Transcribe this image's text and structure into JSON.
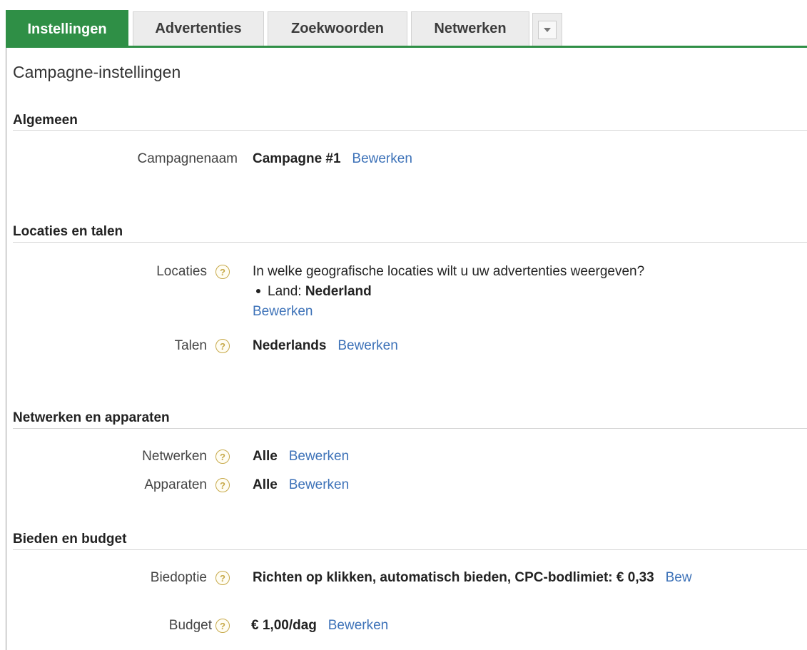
{
  "tabs": [
    {
      "label": "Instellingen",
      "active": true
    },
    {
      "label": "Advertenties",
      "active": false
    },
    {
      "label": "Zoekwoorden",
      "active": false
    },
    {
      "label": "Netwerken",
      "active": false
    }
  ],
  "page_title": "Campagne-instellingen",
  "edit_label": "Bewerken",
  "sections": {
    "algemeen": {
      "title": "Algemeen",
      "campaign_name_label": "Campagnenaam",
      "campaign_name_value": "Campagne #1"
    },
    "locaties": {
      "title": "Locaties en talen",
      "locations_label": "Locaties",
      "locations_question": "In welke geografische locaties wilt u uw advertenties weergeven?",
      "location_prefix": "Land:",
      "location_value": "Nederland",
      "languages_label": "Talen",
      "languages_value": "Nederlands"
    },
    "netwerken": {
      "title": "Netwerken en apparaten",
      "networks_label": "Netwerken",
      "networks_value": "Alle",
      "devices_label": "Apparaten",
      "devices_value": "Alle"
    },
    "bieden": {
      "title": "Bieden en budget",
      "bid_label": "Biedoptie",
      "bid_value": "Richten op klikken, automatisch bieden, CPC-bodlimiet: € 0,33",
      "bid_edit_truncated": "Bew",
      "budget_label": "Budget",
      "budget_value": "€ 1,00/dag"
    }
  },
  "help_glyph": "?",
  "colors": {
    "accent": "#2f8f46",
    "link": "#3d72b8"
  }
}
